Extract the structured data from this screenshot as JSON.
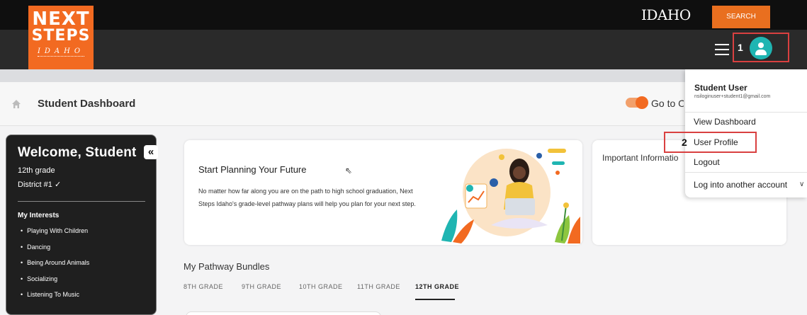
{
  "brand": {
    "line1": "NEXT",
    "line2": "STEPS",
    "line3": "IDAHO",
    "state_mark": "IDAHO",
    "orange": "#f26a21",
    "teal": "#1fb5b2"
  },
  "header": {
    "search_label": "SEARCH",
    "annotation_1": "1",
    "menu_icon": "hamburger-icon",
    "avatar_icon": "user-icon"
  },
  "page": {
    "title": "Student Dashboard",
    "toggle_label": "Go to Or",
    "home_icon": "home-icon"
  },
  "sidebar": {
    "welcome": "Welcome, Student",
    "collapse_label": "«",
    "grade": "12th grade",
    "district": "District #1 ✓",
    "interests_heading": "My Interests",
    "interests": [
      "Playing With Children",
      "Dancing",
      "Being Around Animals",
      "Socializing",
      "Listening To Music"
    ]
  },
  "plan_card": {
    "title": "Start Planning Your Future",
    "text": "No matter how far along you are on the path to high school graduation, Next Steps Idaho's grade-level pathway plans will help you plan for your next step."
  },
  "info_card": {
    "title": "Important Informatio"
  },
  "bundles": {
    "heading": "My Pathway Bundles",
    "tabs": [
      "8TH GRADE",
      "9TH GRADE",
      "10TH GRADE",
      "11TH GRADE",
      "12TH GRADE"
    ],
    "active_tab": "12TH GRADE"
  },
  "user_menu": {
    "name": "Student User",
    "email": "nsiloginuser+student1@gmail.com",
    "items": [
      "View Dashboard",
      "User Profile",
      "Logout",
      "Log into another account"
    ],
    "annotation_2": "2"
  }
}
